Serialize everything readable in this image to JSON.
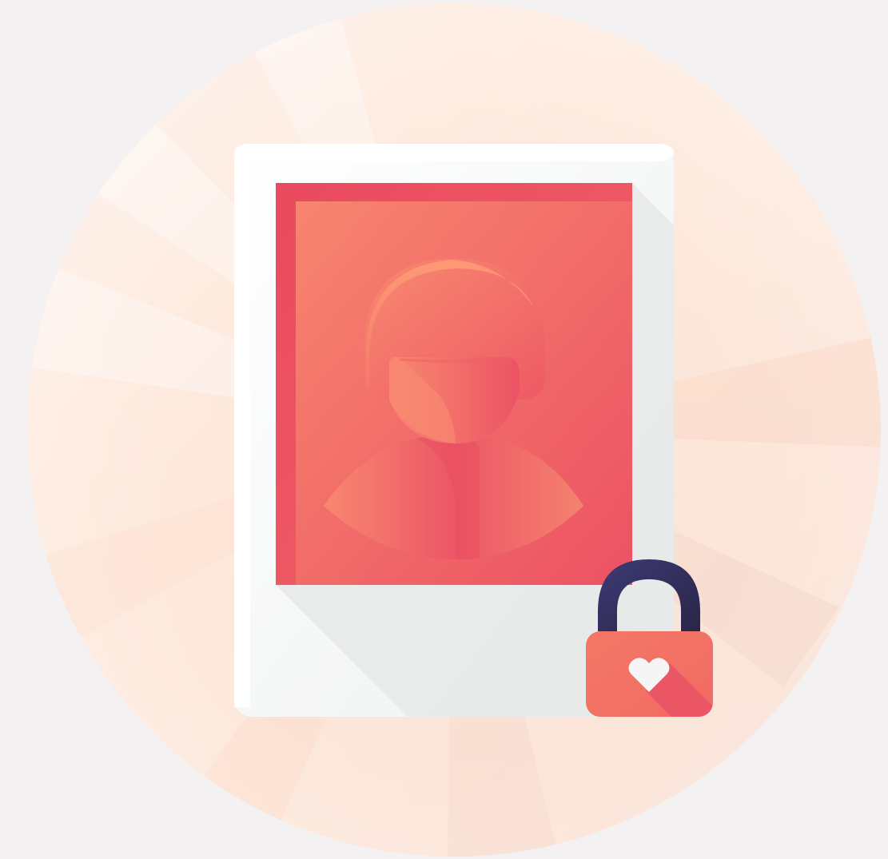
{
  "illustration": {
    "subject": "private-photo",
    "background_color": "#f3f1f1",
    "colors": {
      "halo_light": "#fff4ec",
      "halo_warm": "#fde0d0",
      "frame_white": "#ffffff",
      "frame_gray": "#eceeee",
      "photo_red": "#ec4f60",
      "photo_coral": "#f68a70",
      "hair_peach": "#ff9f78",
      "lock_shackle": "#2e2a52",
      "lock_body": "#f27565",
      "heart": "#f5f5f5"
    },
    "icons": [
      "polaroid-frame-icon",
      "person-silhouette-icon",
      "padlock-icon",
      "heart-icon"
    ]
  }
}
